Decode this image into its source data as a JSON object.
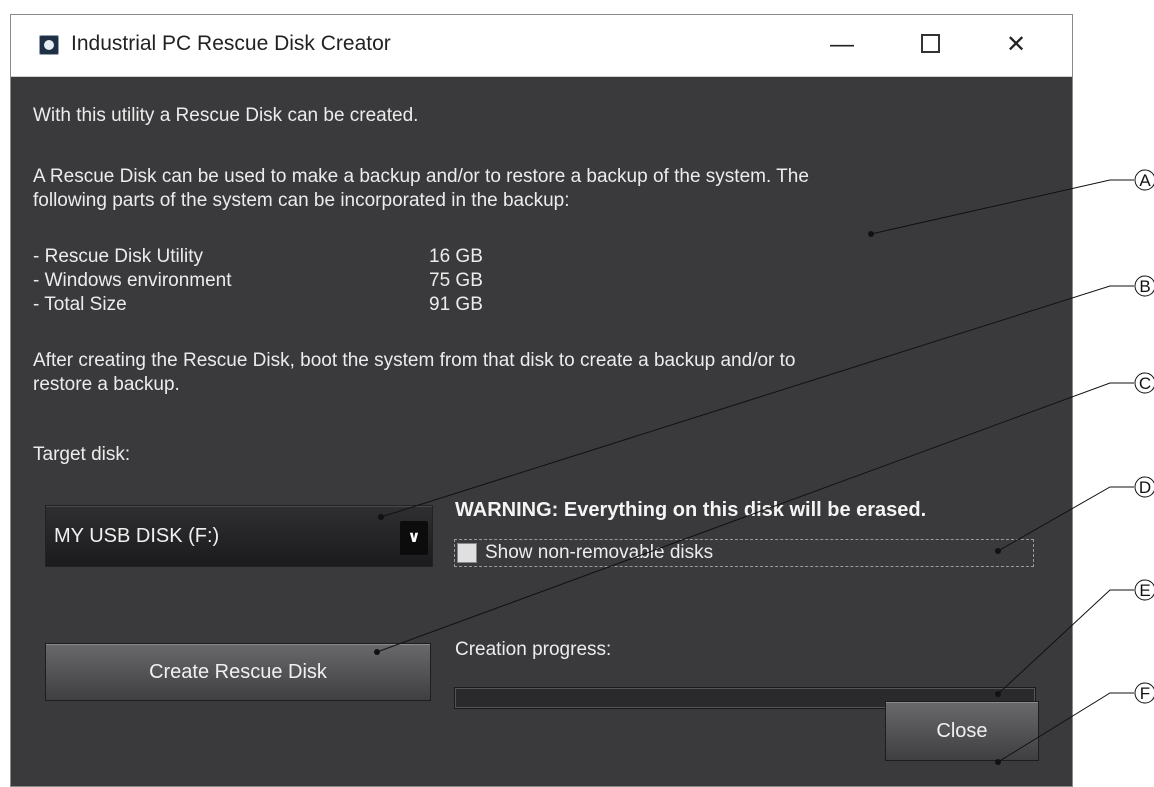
{
  "window": {
    "title": "Industrial PC Rescue Disk Creator",
    "controls": {
      "minimize_icon": "minimize-icon",
      "maximize_icon": "maximize-icon",
      "close_icon": "close-icon"
    }
  },
  "intro": {
    "line1": "With this utility a Rescue Disk can be created.",
    "desc_line1": "A Rescue Disk can be used to make a backup and/or to restore a backup of the system.  The",
    "desc_line2": "following parts of the system can be incorporated in the backup:"
  },
  "parts": [
    {
      "name": "- Rescue Disk Utility",
      "size": "16 GB"
    },
    {
      "name": "- Windows environment",
      "size": "75 GB"
    },
    {
      "name": "- Total Size",
      "size": "91 GB"
    }
  ],
  "after": {
    "line1": "After creating the Rescue Disk, boot the system from that disk to create a backup and/or to",
    "line2": "restore a backup."
  },
  "target": {
    "label": "Target disk:",
    "selected": "MY USB DISK (F:)"
  },
  "warning": "WARNING:  Everything on this disk will be erased.",
  "show_non_removable": {
    "label": "Show non-removable disks",
    "checked": false
  },
  "buttons": {
    "create": "Create Rescue Disk",
    "close": "Close"
  },
  "progress": {
    "label": "Creation progress:",
    "value": 0
  },
  "callouts": [
    "A",
    "B",
    "C",
    "D",
    "E",
    "F"
  ],
  "colors": {
    "window_bg": "#3a3a3c",
    "text": "#ececec",
    "titlebar": "#ffffff"
  }
}
